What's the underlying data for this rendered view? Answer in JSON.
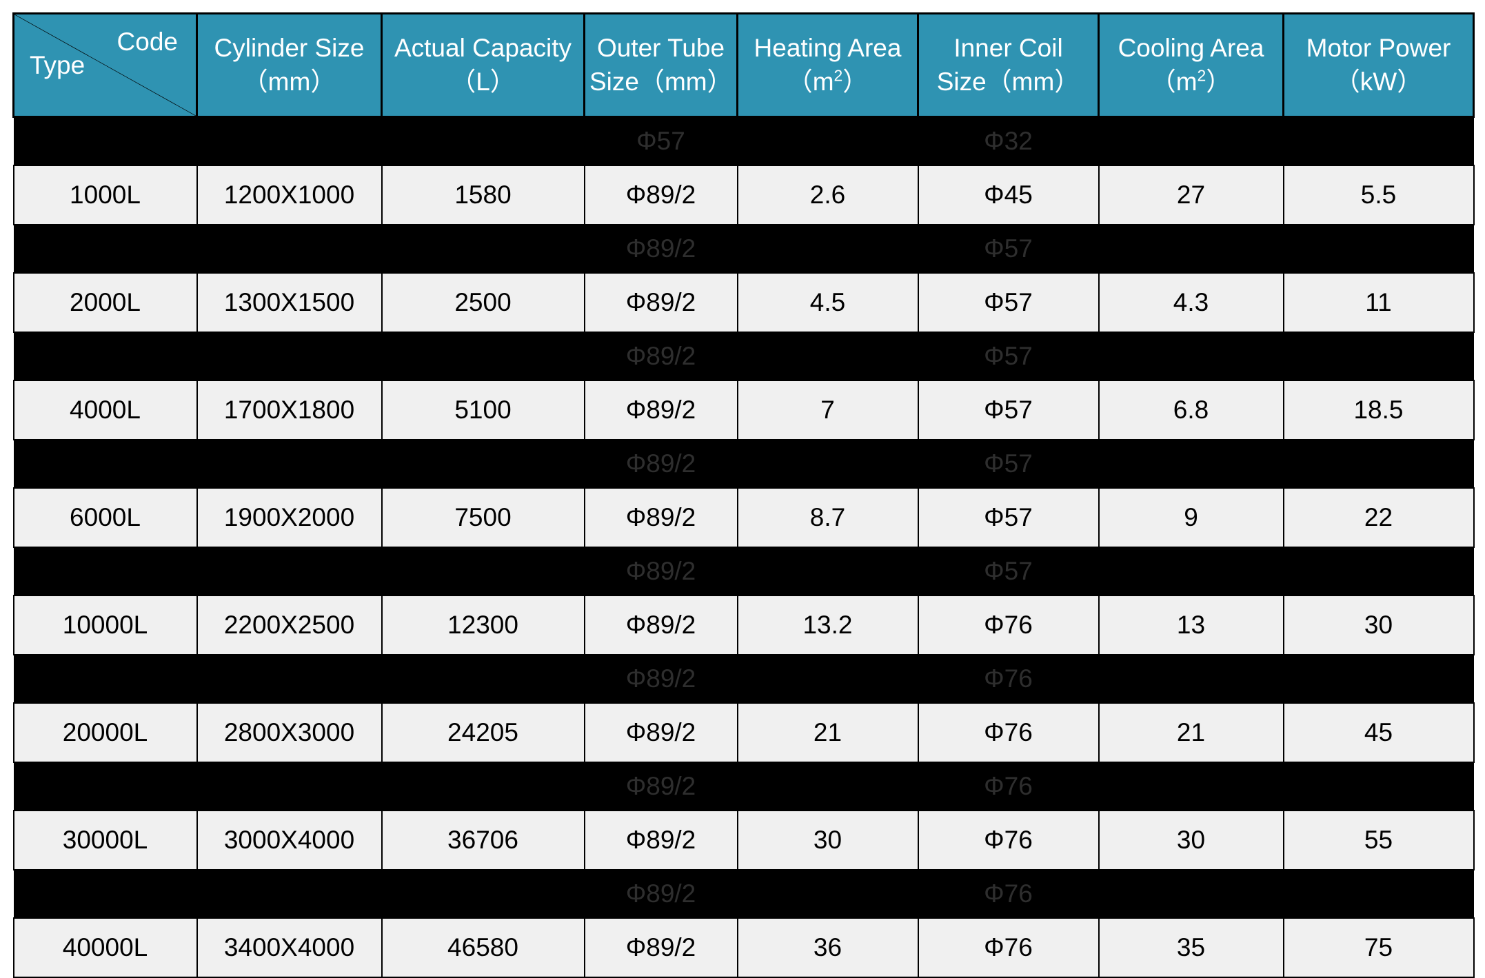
{
  "table": {
    "header": {
      "corner": {
        "code_label": "Code",
        "type_label": "Type"
      },
      "columns": [
        {
          "line1": "Cylinder Size",
          "line2": "（mm）"
        },
        {
          "line1": "Actual Capacity",
          "line2": "（L）"
        },
        {
          "line1": "Outer Tube",
          "line2": "Size（mm）"
        },
        {
          "line1": "Heating Area",
          "line2_pre": "（m",
          "line2_sup": "2",
          "line2_post": "）"
        },
        {
          "line1": "Inner Coil",
          "line2": "Size（mm）"
        },
        {
          "line1": "Cooling Area",
          "line2_pre": "（m",
          "line2_sup": "2",
          "line2_post": "）"
        },
        {
          "line1": "Motor Power",
          "line2": "（kW）"
        }
      ]
    },
    "spacer_rows": [
      {
        "outer_tube": "Φ57",
        "inner_coil": "Φ32"
      },
      {
        "outer_tube": "Φ89/2",
        "inner_coil": "Φ57"
      },
      {
        "outer_tube": "Φ89/2",
        "inner_coil": "Φ57"
      },
      {
        "outer_tube": "Φ89/2",
        "inner_coil": "Φ57"
      },
      {
        "outer_tube": "Φ89/2",
        "inner_coil": "Φ57"
      },
      {
        "outer_tube": "Φ89/2",
        "inner_coil": "Φ76"
      },
      {
        "outer_tube": "Φ89/2",
        "inner_coil": "Φ76"
      },
      {
        "outer_tube": "Φ89/2",
        "inner_coil": "Φ76"
      }
    ],
    "rows": [
      {
        "type": "1000L",
        "cylinder_size": "1200X1000",
        "actual_capacity": "1580",
        "outer_tube_size": "Φ89/2",
        "heating_area": "2.6",
        "inner_coil_size": "Φ45",
        "cooling_area": "27",
        "motor_power": "5.5"
      },
      {
        "type": "2000L",
        "cylinder_size": "1300X1500",
        "actual_capacity": "2500",
        "outer_tube_size": "Φ89/2",
        "heating_area": "4.5",
        "inner_coil_size": "Φ57",
        "cooling_area": "4.3",
        "motor_power": "11"
      },
      {
        "type": "4000L",
        "cylinder_size": "1700X1800",
        "actual_capacity": "5100",
        "outer_tube_size": "Φ89/2",
        "heating_area": "7",
        "inner_coil_size": "Φ57",
        "cooling_area": "6.8",
        "motor_power": "18.5"
      },
      {
        "type": "6000L",
        "cylinder_size": "1900X2000",
        "actual_capacity": "7500",
        "outer_tube_size": "Φ89/2",
        "heating_area": "8.7",
        "inner_coil_size": "Φ57",
        "cooling_area": "9",
        "motor_power": "22"
      },
      {
        "type": "10000L",
        "cylinder_size": "2200X2500",
        "actual_capacity": "12300",
        "outer_tube_size": "Φ89/2",
        "heating_area": "13.2",
        "inner_coil_size": "Φ76",
        "cooling_area": "13",
        "motor_power": "30"
      },
      {
        "type": "20000L",
        "cylinder_size": "2800X3000",
        "actual_capacity": "24205",
        "outer_tube_size": "Φ89/2",
        "heating_area": "21",
        "inner_coil_size": "Φ76",
        "cooling_area": "21",
        "motor_power": "45"
      },
      {
        "type": "30000L",
        "cylinder_size": "3000X4000",
        "actual_capacity": "36706",
        "outer_tube_size": "Φ89/2",
        "heating_area": "30",
        "inner_coil_size": "Φ76",
        "cooling_area": "30",
        "motor_power": "55"
      },
      {
        "type": "40000L",
        "cylinder_size": "3400X4000",
        "actual_capacity": "46580",
        "outer_tube_size": "Φ89/2",
        "heating_area": "36",
        "inner_coil_size": "Φ76",
        "cooling_area": "35",
        "motor_power": "75"
      }
    ]
  },
  "colors": {
    "header_bg": "#2f93b2",
    "header_text": "#ffffff",
    "row_bg": "#f0f0f0",
    "row_text": "#000000",
    "spacer_bg": "#000000",
    "spacer_text": "#2e2e2e",
    "border": "#000000"
  }
}
